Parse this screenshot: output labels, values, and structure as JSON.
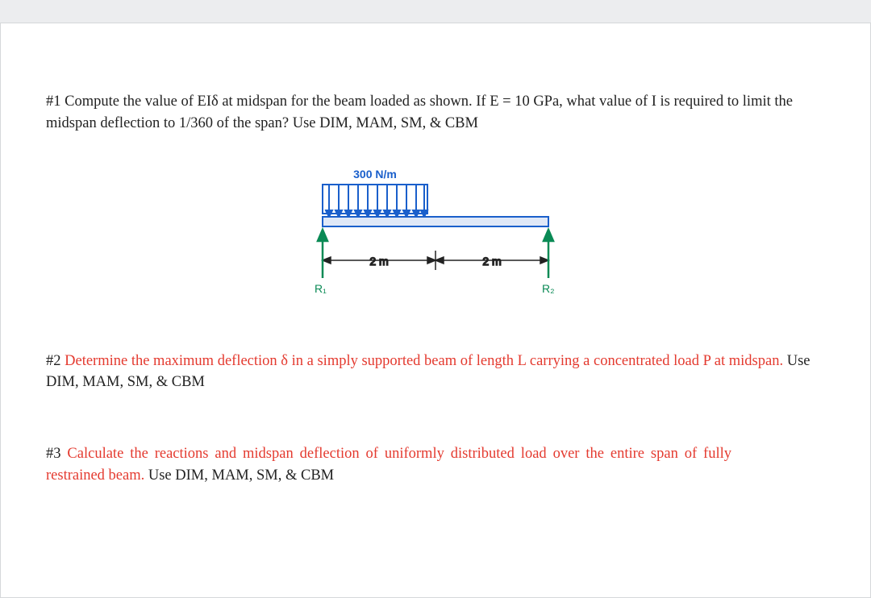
{
  "problems": {
    "p1": {
      "number": "#1",
      "text_a": "Compute the value of EIδ at midspan for the beam loaded as shown. If E = 10 GPa, what value of ",
      "I": "I",
      "text_b": " is required to limit the midspan deflection to 1/360 of the span?",
      "methods": "Use DIM, MAM, SM, & CBM"
    },
    "p2": {
      "number": "#2",
      "text_a": "Determine the maximum deflection δ in a simply supported beam of length L carrying a concentrated load P at midspan.",
      "methods": "Use DIM, MAM, SM, & CBM"
    },
    "p3": {
      "number": "#3",
      "text_a": "Calculate the reactions and midspan deflection of uniformly distributed load over the entire span of fully restrained beam.",
      "methods": "Use DIM, MAM, SM, & CBM"
    }
  },
  "figure": {
    "load_label": "300 N/m",
    "span_left": "2 m",
    "span_right": "2 m",
    "reaction_left": "R₁",
    "reaction_right": "R₂",
    "colors": {
      "load": "#1a5fcb",
      "beam_outline": "#1a5fcb",
      "beam_fill": "#dfe8f7",
      "dims": "#222222",
      "reaction": "#0a8a55"
    }
  }
}
